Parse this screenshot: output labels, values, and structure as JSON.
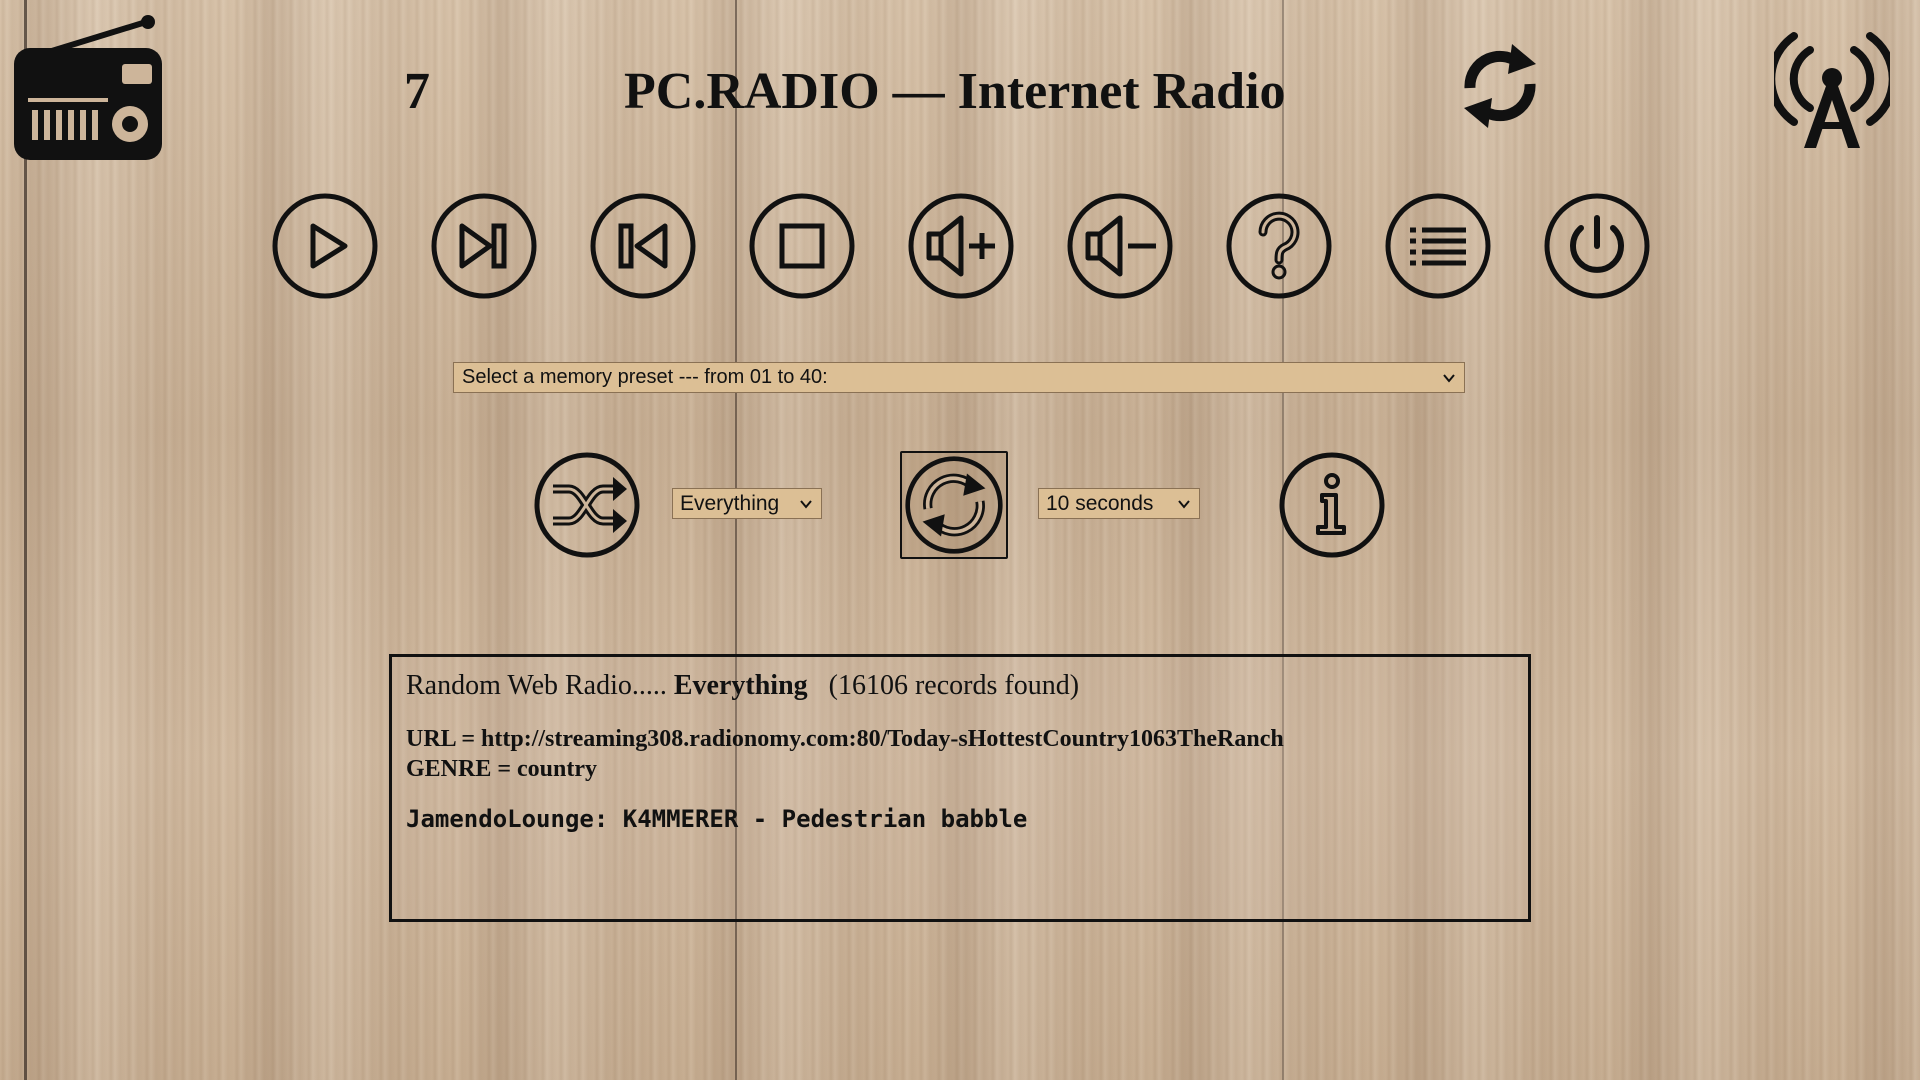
{
  "header": {
    "station_number": "7",
    "title": "PC.RADIO — Internet Radio",
    "logo_icon": "radio-icon",
    "refresh_icon": "refresh-icon",
    "antenna_icon": "radio-tower-icon"
  },
  "controls": [
    {
      "name": "play",
      "icon": "play-icon"
    },
    {
      "name": "next",
      "icon": "skip-next-icon"
    },
    {
      "name": "previous",
      "icon": "skip-previous-icon"
    },
    {
      "name": "stop",
      "icon": "stop-icon"
    },
    {
      "name": "volume-up",
      "icon": "volume-up-icon"
    },
    {
      "name": "volume-down",
      "icon": "volume-down-icon"
    },
    {
      "name": "help",
      "icon": "help-icon"
    },
    {
      "name": "list",
      "icon": "list-icon"
    },
    {
      "name": "power",
      "icon": "power-icon"
    }
  ],
  "preset": {
    "label": "Select a memory preset --- from 01 to 40:"
  },
  "mode": {
    "shuffle_icon": "shuffle-icon",
    "category_selected": "Everything",
    "cycle_icon": "cycle-icon",
    "interval_selected": "10 seconds",
    "info_icon": "info-icon"
  },
  "info": {
    "prefix": "Random Web Radio..... ",
    "category": "Everything",
    "records": "(16106 records found)",
    "url": "URL = http://streaming308.radionomy.com:80/Today-sHottestCountry1063TheRanch",
    "genre": "GENRE = country",
    "now_playing": "JamendoLounge: K4MMERER - Pedestrian babble"
  },
  "colors": {
    "ink": "#111111",
    "select_bg": "#dcbf95",
    "wood": "#cdb59a"
  }
}
